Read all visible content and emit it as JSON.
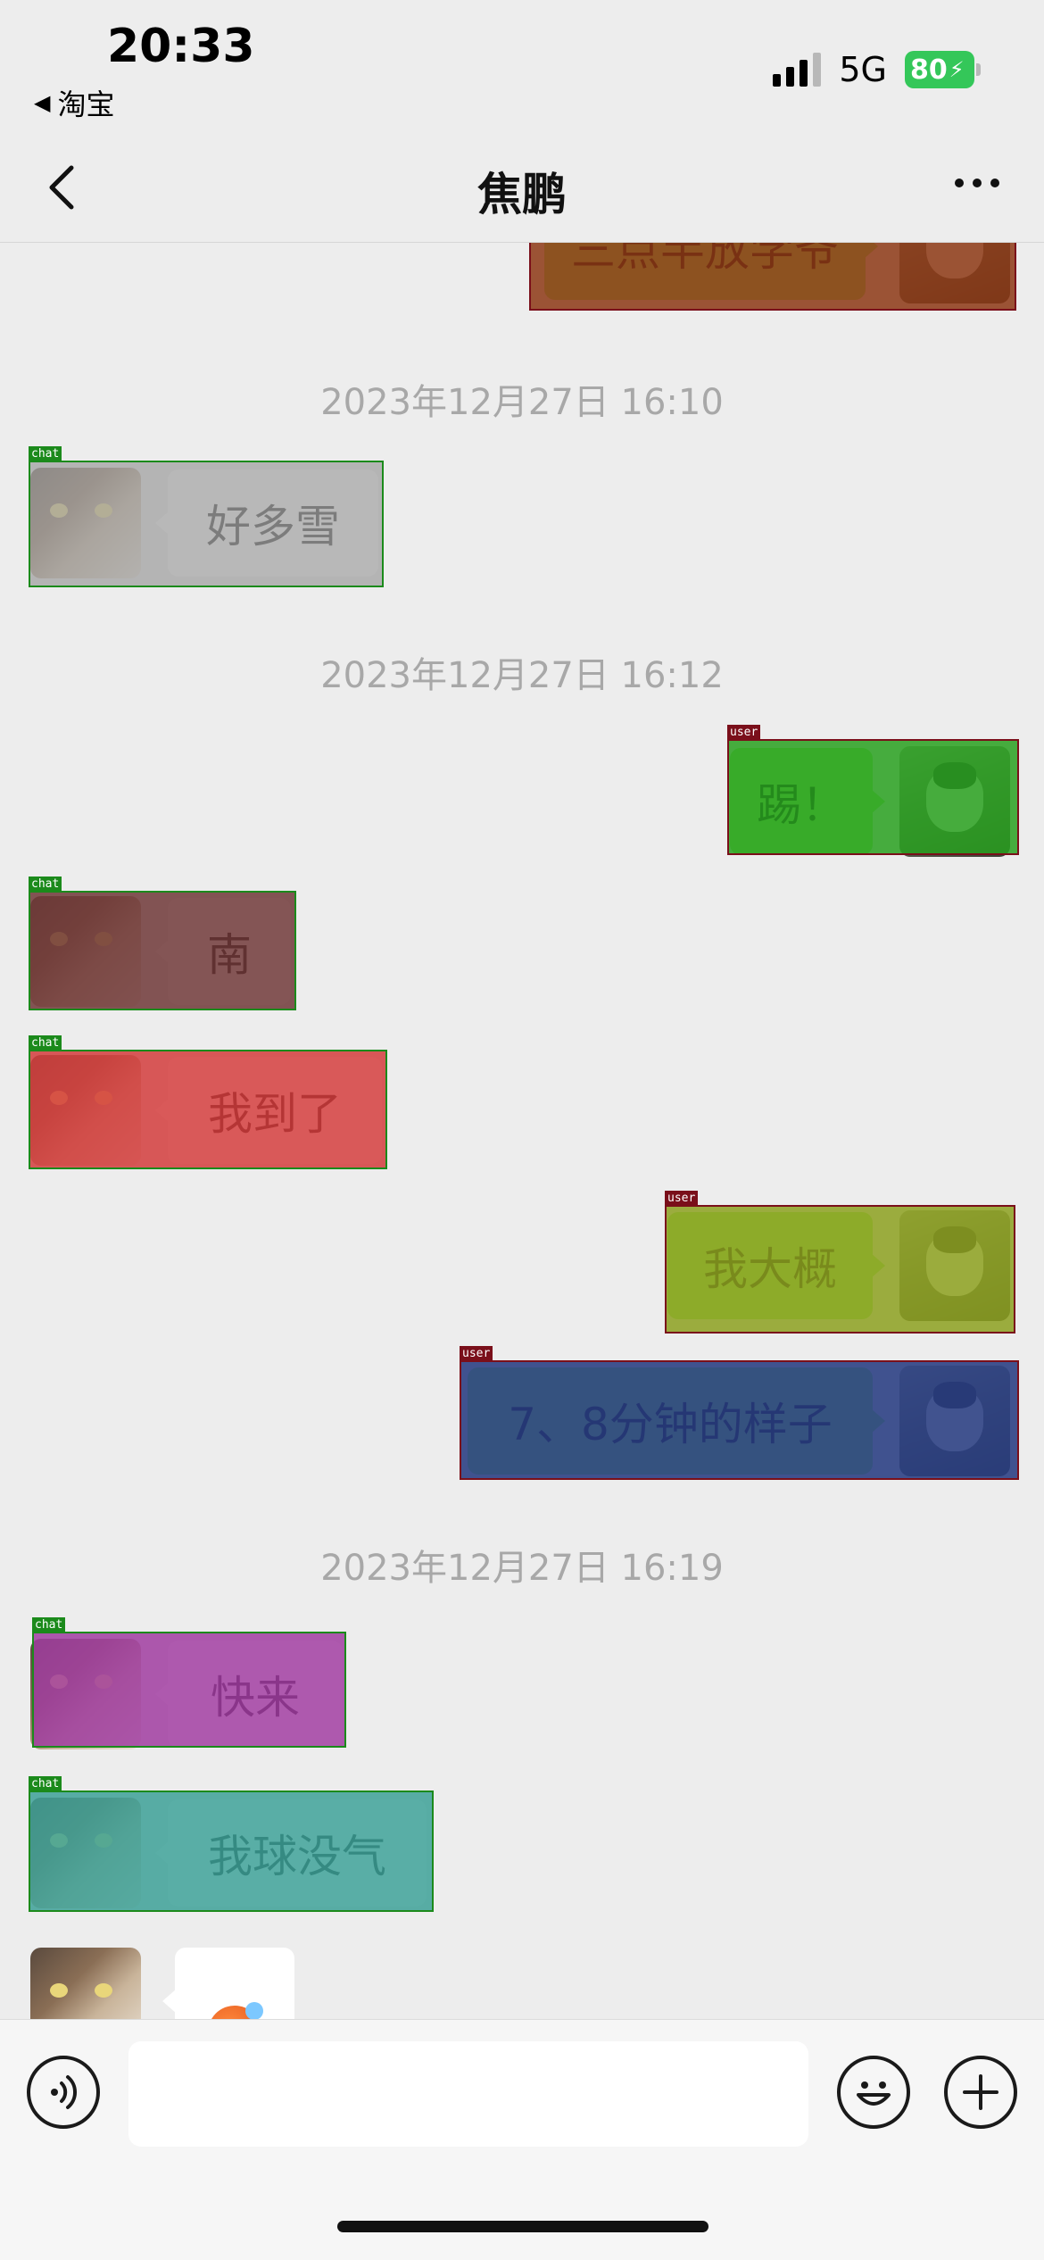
{
  "status_bar": {
    "time": "20:33",
    "back_app": "淘宝",
    "network": "5G",
    "battery": "80"
  },
  "nav": {
    "title": "焦鹏"
  },
  "overlay_tags": {
    "user": "user",
    "chat": "chat"
  },
  "messages": {
    "m0": {
      "sender": "user",
      "text": "三点半放学爷"
    },
    "ts1": "2023年12月27日 16:10",
    "m1": {
      "sender": "chat",
      "text": "好多雪"
    },
    "ts2": "2023年12月27日 16:12",
    "m2": {
      "sender": "user",
      "text": "踢！"
    },
    "m3": {
      "sender": "chat",
      "text": "南"
    },
    "m4": {
      "sender": "chat",
      "text": "我到了"
    },
    "m5": {
      "sender": "user",
      "text": "我大概"
    },
    "m6": {
      "sender": "user",
      "text": "7、8分钟的样子"
    },
    "ts3": "2023年12月27日 16:19",
    "m7": {
      "sender": "chat",
      "text": "快来"
    },
    "m8": {
      "sender": "chat",
      "text": "我球没气"
    },
    "m9": {
      "sender": "chat",
      "emoji": "sweating-face"
    }
  },
  "colors": {
    "background": "#ededed",
    "bubble_self": "#95ec69",
    "bubble_other": "#ffffff",
    "timestamp": "#a8a8a8",
    "battery": "#34c759",
    "overlay_user_border": "#7a0f1a",
    "overlay_chat_border": "#1b8a1b"
  },
  "overlay_fills": {
    "m0": "rgba(140,55,20,0.85)",
    "m1": "rgba(160,160,160,0.75)",
    "m2": "rgba(40,160,30,0.85)",
    "m3": "rgba(110,55,55,0.85)",
    "m4": "rgba(210,60,60,0.85)",
    "m5": "rgba(140,160,30,0.85)",
    "m6": "rgba(40,60,130,0.88)",
    "m7": "rgba(160,60,160,0.85)",
    "m8": "rgba(60,160,150,0.85)"
  },
  "input_bar": {
    "placeholder": "",
    "icons": [
      "voice-icon",
      "emoji-icon",
      "plus-icon"
    ]
  }
}
